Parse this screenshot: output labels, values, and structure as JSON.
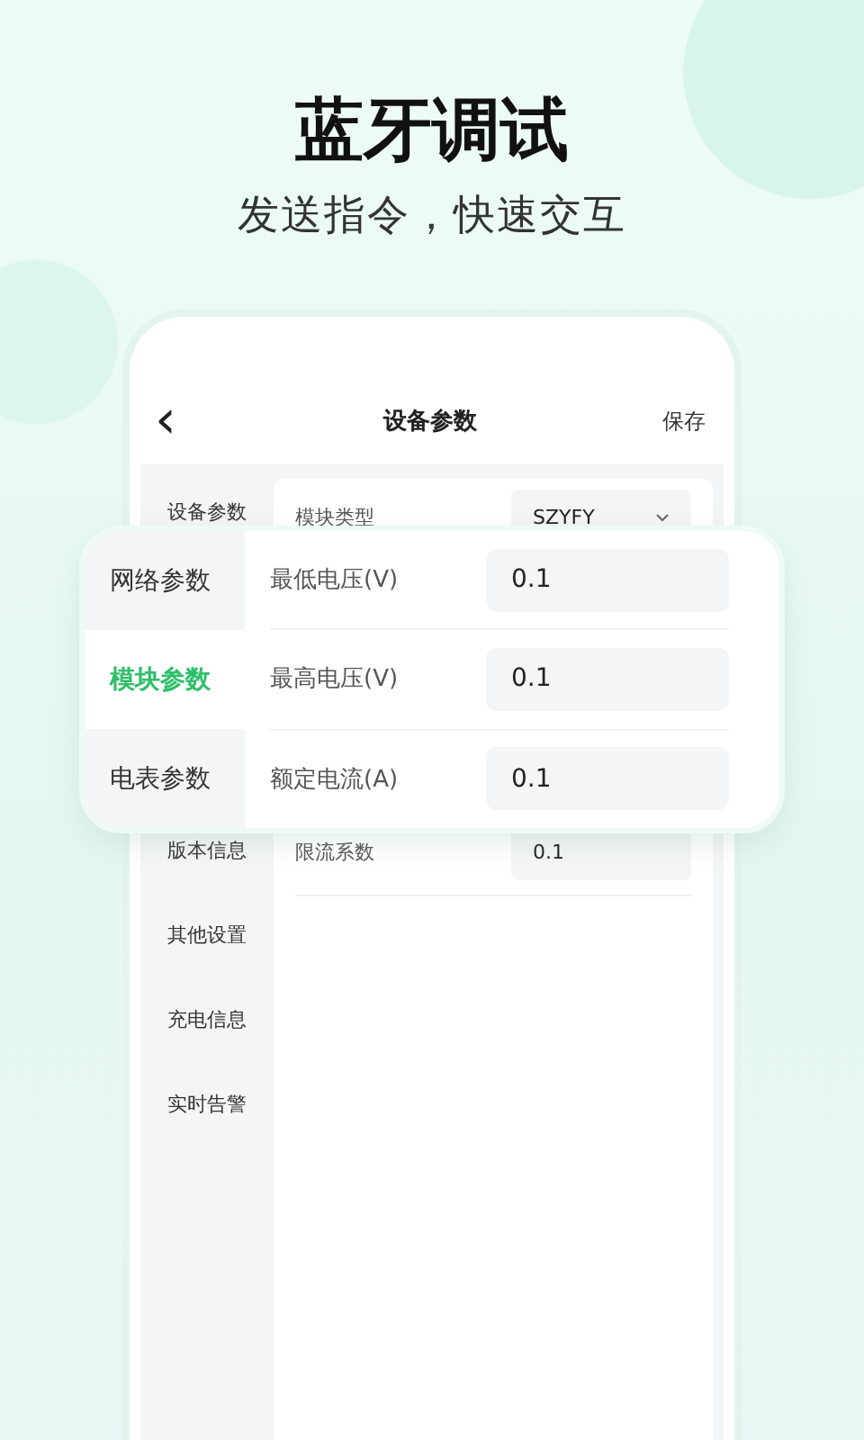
{
  "header": {
    "title": "蓝牙调试",
    "subtitle": "发送指令，快速交互"
  },
  "phone": {
    "nav": {
      "back": "‹",
      "title": "设备参数",
      "action": "保存"
    },
    "sidebar_top": [
      {
        "label": "设备参数",
        "selected": false
      }
    ],
    "sidebar_bottom": [
      {
        "label": "版本信息",
        "selected": false
      },
      {
        "label": "其他设置",
        "selected": false
      },
      {
        "label": "充电信息",
        "selected": false
      },
      {
        "label": "实时告警",
        "selected": false
      }
    ],
    "select_row": {
      "label": "模块类型",
      "value": "SZYFY"
    },
    "bottom_rows": [
      {
        "label": "限流系数",
        "value": "0.1"
      }
    ]
  },
  "popup": {
    "tabs": [
      {
        "label": "网络参数",
        "selected": false
      },
      {
        "label": "模块参数",
        "selected": true
      },
      {
        "label": "电表参数",
        "selected": false
      }
    ],
    "rows": [
      {
        "label": "最低电压(V)",
        "value": "0.1"
      },
      {
        "label": "最高电压(V)",
        "value": "0.1"
      },
      {
        "label": "额定电流(A)",
        "value": "0.1"
      }
    ]
  }
}
